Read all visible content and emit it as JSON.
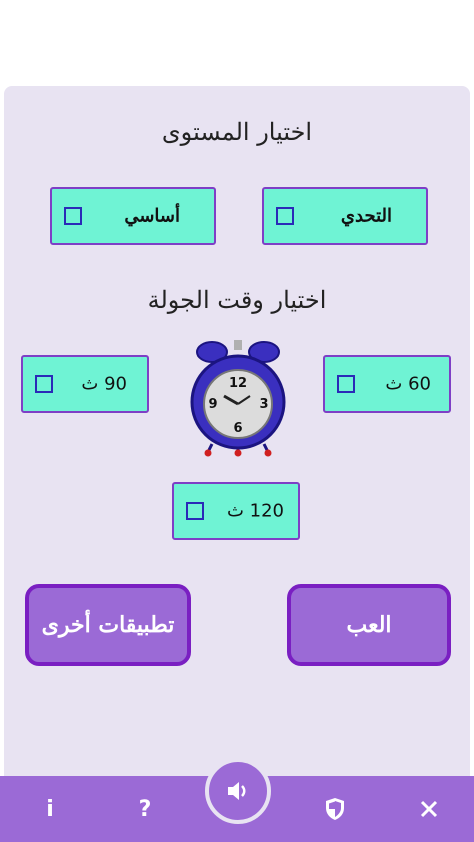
{
  "level": {
    "title": "اختيار المستوى",
    "options": [
      {
        "label": "التحدي"
      },
      {
        "label": "أساسي"
      }
    ]
  },
  "round": {
    "title": "اختيار وقت الجولة",
    "options": [
      {
        "label": "60 ث"
      },
      {
        "label": "90 ث"
      },
      {
        "label": "120 ث"
      }
    ]
  },
  "clock": {
    "numbers": [
      "12",
      "3",
      "6",
      "9"
    ]
  },
  "buttons": {
    "play": "العب",
    "other_apps": "تطبيقات أخرى"
  },
  "bottom_bar": {
    "info": "i",
    "help": "?"
  },
  "colors": {
    "accent": "#9b6ad6",
    "option_bg": "#6ff3d4",
    "panel": "#e8e3f2"
  }
}
